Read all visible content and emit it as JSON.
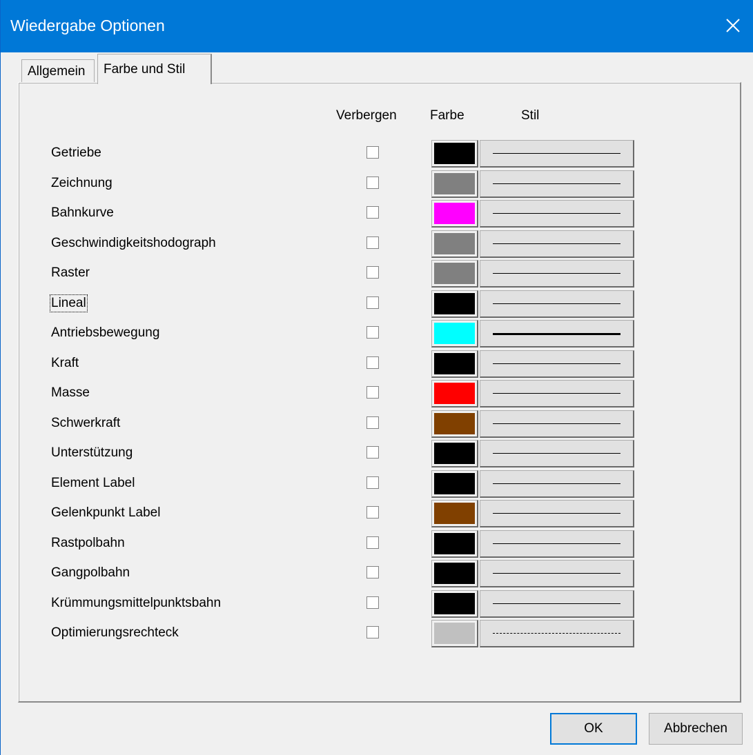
{
  "window": {
    "title": "Wiedergabe Optionen",
    "close_icon": "close-icon"
  },
  "tabs": [
    {
      "label": "Allgemein",
      "active": false
    },
    {
      "label": "Farbe und Stil",
      "active": true
    }
  ],
  "columns": {
    "hide": "Verbergen",
    "color": "Farbe",
    "style": "Stil"
  },
  "rows": [
    {
      "label": "Getriebe",
      "hidden": false,
      "color": "#000000",
      "line_style": "solid",
      "line_weight": "thin"
    },
    {
      "label": "Zeichnung",
      "hidden": false,
      "color": "#808080",
      "line_style": "solid",
      "line_weight": "thin"
    },
    {
      "label": "Bahnkurve",
      "hidden": false,
      "color": "#ff00ff",
      "line_style": "solid",
      "line_weight": "thin"
    },
    {
      "label": "Geschwindigkeitshodograph",
      "hidden": false,
      "color": "#808080",
      "line_style": "solid",
      "line_weight": "thin"
    },
    {
      "label": "Raster",
      "hidden": false,
      "color": "#808080",
      "line_style": "solid",
      "line_weight": "thin"
    },
    {
      "label": "Lineal",
      "hidden": false,
      "color": "#000000",
      "line_style": "solid",
      "line_weight": "thin"
    },
    {
      "label": "Antriebsbewegung",
      "hidden": false,
      "color": "#00ffff",
      "line_style": "solid",
      "line_weight": "thick"
    },
    {
      "label": "Kraft",
      "hidden": false,
      "color": "#000000",
      "line_style": "solid",
      "line_weight": "thin"
    },
    {
      "label": "Masse",
      "hidden": false,
      "color": "#ff0000",
      "line_style": "solid",
      "line_weight": "thin"
    },
    {
      "label": "Schwerkraft",
      "hidden": false,
      "color": "#804000",
      "line_style": "solid",
      "line_weight": "thin"
    },
    {
      "label": "Unterstützung",
      "hidden": false,
      "color": "#000000",
      "line_style": "solid",
      "line_weight": "thin"
    },
    {
      "label": "Element Label",
      "hidden": false,
      "color": "#000000",
      "line_style": "solid",
      "line_weight": "thin"
    },
    {
      "label": "Gelenkpunkt Label",
      "hidden": false,
      "color": "#804000",
      "line_style": "solid",
      "line_weight": "thin"
    },
    {
      "label": "Rastpolbahn",
      "hidden": false,
      "color": "#000000",
      "line_style": "solid",
      "line_weight": "thin"
    },
    {
      "label": "Gangpolbahn",
      "hidden": false,
      "color": "#000000",
      "line_style": "solid",
      "line_weight": "thin"
    },
    {
      "label": "Krümmungsmittelpunktsbahn",
      "hidden": false,
      "color": "#000000",
      "line_style": "solid",
      "line_weight": "thin"
    },
    {
      "label": "Optimierungsrechteck",
      "hidden": false,
      "color": "#c0c0c0",
      "line_style": "dashed",
      "line_weight": "thin"
    }
  ],
  "focused_row": "Lineal",
  "buttons": {
    "ok": "OK",
    "cancel": "Abbrechen"
  }
}
